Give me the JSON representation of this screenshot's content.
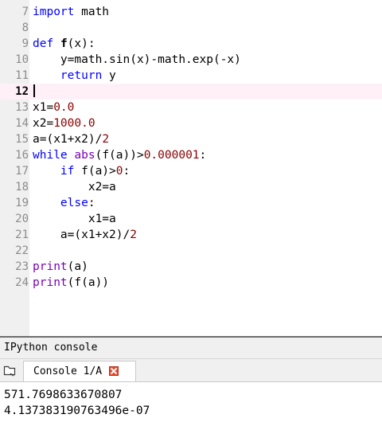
{
  "editor": {
    "current_line": 12,
    "lines": [
      {
        "num": "7",
        "tokens": [
          {
            "t": "import",
            "c": "kw"
          },
          {
            "t": " math",
            "c": ""
          }
        ]
      },
      {
        "num": "8",
        "tokens": []
      },
      {
        "num": "9",
        "tokens": [
          {
            "t": "def",
            "c": "kw"
          },
          {
            "t": " ",
            "c": ""
          },
          {
            "t": "f",
            "c": "fn"
          },
          {
            "t": "(x):",
            "c": ""
          }
        ]
      },
      {
        "num": "10",
        "tokens": [
          {
            "t": "    y=math.sin(x)-math.exp(-x)",
            "c": ""
          }
        ]
      },
      {
        "num": "11",
        "tokens": [
          {
            "t": "    ",
            "c": ""
          },
          {
            "t": "return",
            "c": "kw"
          },
          {
            "t": " y",
            "c": ""
          }
        ]
      },
      {
        "num": "12",
        "tokens": []
      },
      {
        "num": "13",
        "tokens": [
          {
            "t": "x1=",
            "c": ""
          },
          {
            "t": "0.0",
            "c": "num"
          }
        ]
      },
      {
        "num": "14",
        "tokens": [
          {
            "t": "x2=",
            "c": ""
          },
          {
            "t": "1000.0",
            "c": "num"
          }
        ]
      },
      {
        "num": "15",
        "tokens": [
          {
            "t": "a=(x1+x2)/",
            "c": ""
          },
          {
            "t": "2",
            "c": "num"
          }
        ]
      },
      {
        "num": "16",
        "tokens": [
          {
            "t": "while",
            "c": "kw"
          },
          {
            "t": " ",
            "c": ""
          },
          {
            "t": "abs",
            "c": "bi"
          },
          {
            "t": "(f(a))>",
            "c": ""
          },
          {
            "t": "0.000001",
            "c": "num"
          },
          {
            "t": ":",
            "c": ""
          }
        ]
      },
      {
        "num": "17",
        "tokens": [
          {
            "t": "    ",
            "c": ""
          },
          {
            "t": "if",
            "c": "kw"
          },
          {
            "t": " f(a)>",
            "c": ""
          },
          {
            "t": "0",
            "c": "num"
          },
          {
            "t": ":",
            "c": ""
          }
        ]
      },
      {
        "num": "18",
        "tokens": [
          {
            "t": "        x2=a",
            "c": ""
          }
        ]
      },
      {
        "num": "19",
        "tokens": [
          {
            "t": "    ",
            "c": ""
          },
          {
            "t": "else",
            "c": "kw"
          },
          {
            "t": ":",
            "c": ""
          }
        ]
      },
      {
        "num": "20",
        "tokens": [
          {
            "t": "        x1=a",
            "c": ""
          }
        ]
      },
      {
        "num": "21",
        "tokens": [
          {
            "t": "    a=(x1+x2)/",
            "c": ""
          },
          {
            "t": "2",
            "c": "num"
          }
        ]
      },
      {
        "num": "22",
        "tokens": []
      },
      {
        "num": "23",
        "tokens": [
          {
            "t": "print",
            "c": "bi"
          },
          {
            "t": "(a)",
            "c": ""
          }
        ]
      },
      {
        "num": "24",
        "tokens": [
          {
            "t": "print",
            "c": "bi"
          },
          {
            "t": "(f(a))",
            "c": ""
          }
        ]
      }
    ]
  },
  "console": {
    "title": "IPython console",
    "tab_label": "Console 1/A",
    "browse_icon": "folder-browse-icon",
    "close_icon": "close-tab-icon",
    "output": [
      "571.7698633670807",
      "4.137383190763496e-07"
    ]
  },
  "colors": {
    "keyword": "#0000ff",
    "number": "#8b0000",
    "builtin": "#7a00b8",
    "current_line_bg": "#fff0f8",
    "gutter_bg": "#f0f0f0"
  }
}
